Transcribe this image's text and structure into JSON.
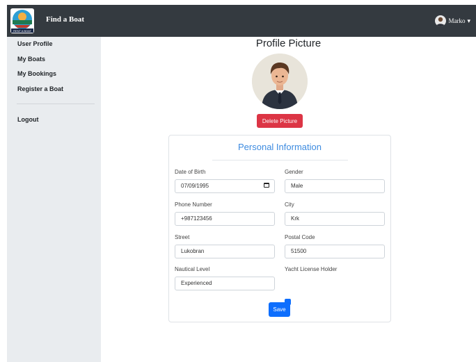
{
  "navbar": {
    "logo_text": "RENT A BOAT",
    "brand": "Find a Boat",
    "user_name": "Marko",
    "caret": "▾"
  },
  "sidebar": {
    "items": [
      {
        "label": "User Profile"
      },
      {
        "label": "My Boats"
      },
      {
        "label": "My Bookings"
      },
      {
        "label": "Register a Boat"
      }
    ],
    "logout": "Logout"
  },
  "profile_picture": {
    "title": "Profile Picture",
    "delete_label": "Delete Picture"
  },
  "personal_info": {
    "title": "Personal Information",
    "fields": {
      "dob": {
        "label": "Date of Birth",
        "value": "07/09/1995"
      },
      "gender": {
        "label": "Gender",
        "value": "Male"
      },
      "phone": {
        "label": "Phone Number",
        "value": "+987123456"
      },
      "city": {
        "label": "City",
        "value": "Krk"
      },
      "street": {
        "label": "Street",
        "value": "Lukobran"
      },
      "postal": {
        "label": "Postal Code",
        "value": "51500"
      },
      "nautical": {
        "label": "Nautical Level",
        "value": "Experienced"
      },
      "yacht": {
        "label": "Yacht License Holder",
        "checked": true
      }
    },
    "save_label": "Save"
  },
  "colors": {
    "navbar": "#343a40",
    "sidebar": "#e9ecef",
    "delete": "#dc3545",
    "primary": "#0d6efd",
    "heading": "#3d8be0"
  }
}
